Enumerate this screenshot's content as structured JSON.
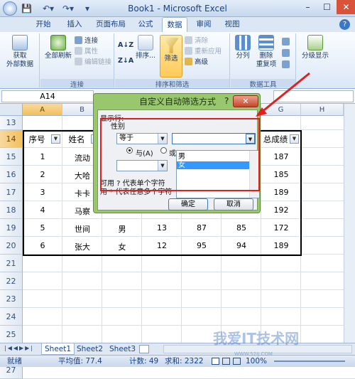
{
  "window": {
    "title": "Book1 - Microsoft Excel",
    "min": "–",
    "max": "☐",
    "close": "✕"
  },
  "qat": {
    "save": "💾",
    "undo": "↶▾",
    "redo": "↷▾",
    "more": "▾"
  },
  "tabs": [
    {
      "label": "开始"
    },
    {
      "label": "插入"
    },
    {
      "label": "页面布局"
    },
    {
      "label": "公式"
    },
    {
      "label": "数据",
      "active": true
    },
    {
      "label": "审阅"
    },
    {
      "label": "视图"
    }
  ],
  "ribbon": {
    "get_external_data": "获取\n外部数据",
    "refresh_all": "全部刷新",
    "connections": "连接",
    "properties": "属性",
    "edit_links": "编辑链接",
    "group_connections": "连接",
    "sort_az": "A↓Z",
    "sort_za": "Z↓A",
    "sort": "排序...",
    "filter": "筛选",
    "clear": "清除",
    "reapply": "重新应用",
    "advanced": "高级",
    "group_sort_filter": "排序和筛选",
    "split": "分列",
    "remove_dup": "删除\n重复项",
    "group_data_tools": "数据工具",
    "outline": "分级显示"
  },
  "formula_bar": {
    "name_box": "A14"
  },
  "columns": [
    "A",
    "B",
    "C",
    "D",
    "E",
    "F",
    "G",
    "H"
  ],
  "rows": [
    "13",
    "14",
    "15",
    "16",
    "17",
    "18",
    "19",
    "20",
    "21",
    "22",
    "23",
    "24",
    "25",
    "26",
    "27"
  ],
  "table": {
    "headers": [
      "序号",
      "姓名",
      "",
      "",
      "",
      "",
      "总成绩"
    ],
    "rows": [
      [
        "1",
        "流动",
        "",
        "",
        "",
        "",
        "187"
      ],
      [
        "2",
        "大哈",
        "",
        "",
        "",
        "",
        "185"
      ],
      [
        "3",
        "卡卡",
        "",
        "",
        "",
        "",
        "189"
      ],
      [
        "4",
        "马察",
        "",
        "",
        "",
        "",
        "192"
      ],
      [
        "5",
        "世间",
        "男",
        "13",
        "87",
        "85",
        "172"
      ],
      [
        "6",
        "张大",
        "女",
        "12",
        "95",
        "94",
        "189"
      ]
    ]
  },
  "dialog": {
    "title": "自定义自动筛选方式",
    "help": "?",
    "close": "✕",
    "show_rows": "显示行:",
    "field": "性别",
    "op1": "等于",
    "val1": "",
    "and_label": "与(A)",
    "or_label": "或",
    "list_items": [
      "男",
      "女"
    ],
    "hint1": "可用 ? 代表单个字符",
    "hint2": "用 * 代表任意多个字符",
    "ok": "确定",
    "cancel": "取消"
  },
  "sheets": [
    {
      "label": "Sheet1",
      "active": true
    },
    {
      "label": "Sheet2"
    },
    {
      "label": "Sheet3"
    }
  ],
  "status": {
    "ready": "就绪",
    "average": "平均值: 77.4",
    "count": "计数: 49",
    "sum": "求和: 2322",
    "zoom": "100%"
  },
  "watermark": {
    "text": "我爱IT技术网",
    "sub": "WWW.52IJ.COM"
  },
  "colors": {
    "accent": "#e02020",
    "dialog": "#98c76e",
    "selection": "#3399ff"
  }
}
